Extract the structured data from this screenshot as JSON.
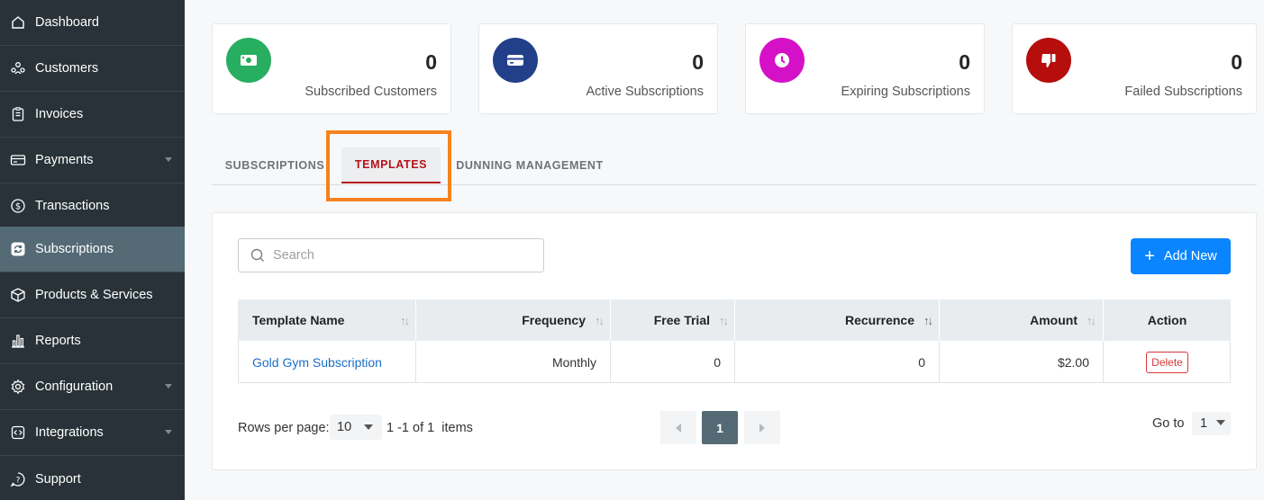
{
  "sidebar": {
    "items": [
      {
        "label": "Dashboard",
        "icon": "home-icon"
      },
      {
        "label": "Customers",
        "icon": "customers-icon"
      },
      {
        "label": "Invoices",
        "icon": "invoice-icon"
      },
      {
        "label": "Payments",
        "icon": "payment-card-icon",
        "has_caret": true
      },
      {
        "label": "Transactions",
        "icon": "dollar-circle-icon"
      },
      {
        "label": "Subscriptions",
        "icon": "refresh-icon",
        "active": true
      },
      {
        "label": "Products & Services",
        "icon": "box-icon"
      },
      {
        "label": "Reports",
        "icon": "bar-chart-icon"
      },
      {
        "label": "Configuration",
        "icon": "gear-icon",
        "has_caret": true
      },
      {
        "label": "Integrations",
        "icon": "integrations-icon",
        "has_caret": true
      },
      {
        "label": "Support",
        "icon": "help-icon"
      }
    ]
  },
  "stats": [
    {
      "value": "0",
      "label": "Subscribed Customers",
      "color": "#27ae60",
      "icon": "money-icon"
    },
    {
      "value": "0",
      "label": "Active Subscriptions",
      "color": "#22408a",
      "icon": "credit-card-icon"
    },
    {
      "value": "0",
      "label": "Expiring Subscriptions",
      "color": "#d511c8",
      "icon": "clock-icon"
    },
    {
      "value": "0",
      "label": "Failed Subscriptions",
      "color": "#b60d0d",
      "icon": "thumbs-down-icon"
    }
  ],
  "tabs": [
    {
      "label": "SUBSCRIPTIONS",
      "active": false
    },
    {
      "label": "TEMPLATES",
      "active": true
    },
    {
      "label": "DUNNING MANAGEMENT",
      "active": false
    }
  ],
  "search": {
    "placeholder": "Search",
    "value": ""
  },
  "add_button": {
    "label": "Add New"
  },
  "table": {
    "columns": [
      "Template Name",
      "Frequency",
      "Free Trial",
      "Recurrence",
      "Amount",
      "Action"
    ],
    "rows": [
      {
        "template_name": "Gold Gym Subscription",
        "frequency": "Monthly",
        "free_trial": "0",
        "recurrence": "0",
        "amount": "$2.00",
        "action": "Delete"
      }
    ]
  },
  "pagination": {
    "rows_per_page_label": "Rows per page:",
    "rows_per_page": "10",
    "items_text": "1 -1 of 1  items",
    "current_page": "1",
    "goto_label": "Go to",
    "goto_value": "1"
  },
  "colors": {
    "accent": "#0a84ff",
    "active_tab": "#b5121b",
    "highlight": "#f5821f",
    "sidebar_bg": "#283238",
    "sidebar_active": "#546a75"
  }
}
